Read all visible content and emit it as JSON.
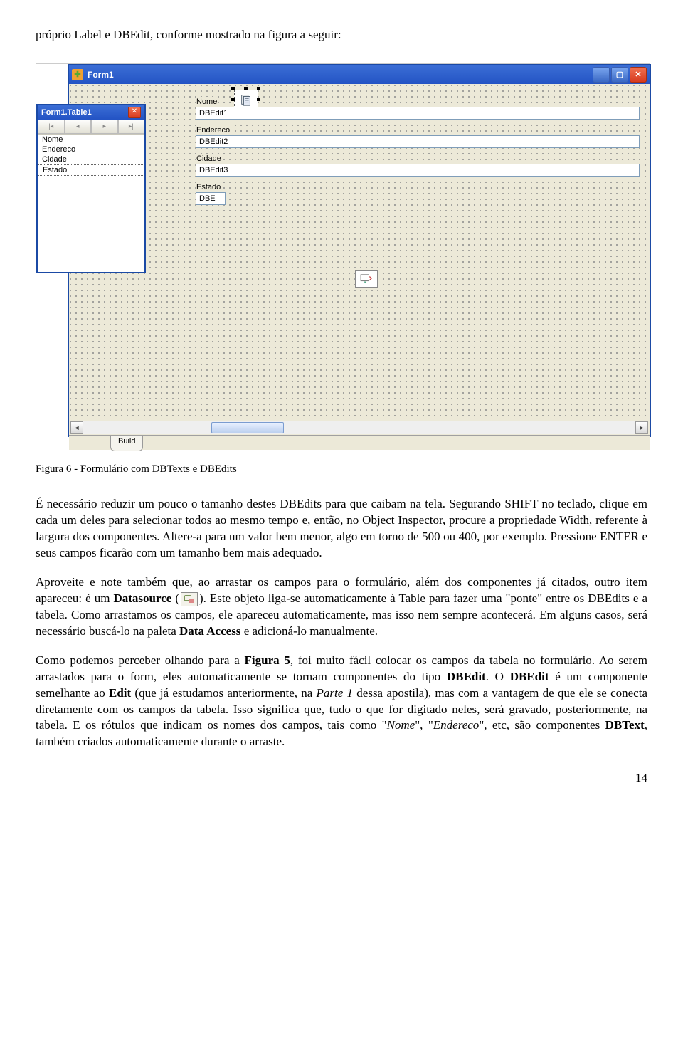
{
  "intro": "próprio Label e DBEdit, conforme mostrado na figura a seguir:",
  "caption": "Figura 6 - Formulário com DBTexts e DBEdits",
  "para1": "É necessário reduzir um pouco o tamanho destes DBEdits para que caibam na tela. Segurando SHIFT no teclado, clique em cada um deles para selecionar todos ao mesmo tempo e, então, no Object Inspector, procure a propriedade Width, referente à largura dos componentes. Altere-a para um valor bem menor, algo em torno de 500 ou 400, por exemplo. Pressione ENTER e seus campos ficarão com um tamanho bem mais adequado.",
  "para2a": "Aproveite e note também que, ao arrastar os campos para o formulário, além dos componentes já citados, outro item apareceu: é um ",
  "para2b": "Datasource",
  "para2c": " (",
  "para2d": "). Este objeto liga-se automaticamente à Table para fazer uma \"ponte\" entre os DBEdits e a tabela. Como arrastamos os campos, ele apareceu automaticamente, mas isso nem sempre acontecerá. Em alguns casos, será necessário buscá-lo na paleta ",
  "para2e": "Data Access",
  "para2f": " e adicioná-lo manualmente.",
  "para3a": "Como podemos perceber olhando para a ",
  "para3b": "Figura 5",
  "para3c": ", foi muito fácil colocar os campos da tabela no formulário. Ao serem arrastados para o form, eles automaticamente se tornam componentes do tipo ",
  "para3d": "DBEdit",
  "para3e": ". O ",
  "para3f": "DBEdit",
  "para3g": " é um componente semelhante ao ",
  "para3h": "Edit ",
  "para3i": "(que já estudamos anteriormente, na ",
  "para3j": "Parte 1",
  "para3k": " dessa apostila), mas com a vantagem de que ele se conecta diretamente com os campos da tabela. Isso significa que, tudo o que for digitado neles, será gravado, posteriormente, na tabela. E os rótulos que indicam os nomes dos campos, tais como \"",
  "para3l": "Nome",
  "para3m": "\", \"",
  "para3n": "Endereco",
  "para3o": "\", etc, são componentes ",
  "para3p": "DBText",
  "para3q": ", também criados automaticamente durante o arraste.",
  "pagenum": "14",
  "form": {
    "title": "Form1",
    "tab": "Build",
    "labels": {
      "nome": "Nome",
      "endereco": "Endereco",
      "cidade": "Cidade",
      "estado": "Estado"
    },
    "edits": {
      "nome": "DBEdit1",
      "endereco": "DBEdit2",
      "cidade": "DBEdit3",
      "estado": "DBE"
    }
  },
  "palette": {
    "title": "Form1.Table1",
    "fields": [
      "Nome",
      "Endereco",
      "Cidade",
      "Estado"
    ]
  }
}
